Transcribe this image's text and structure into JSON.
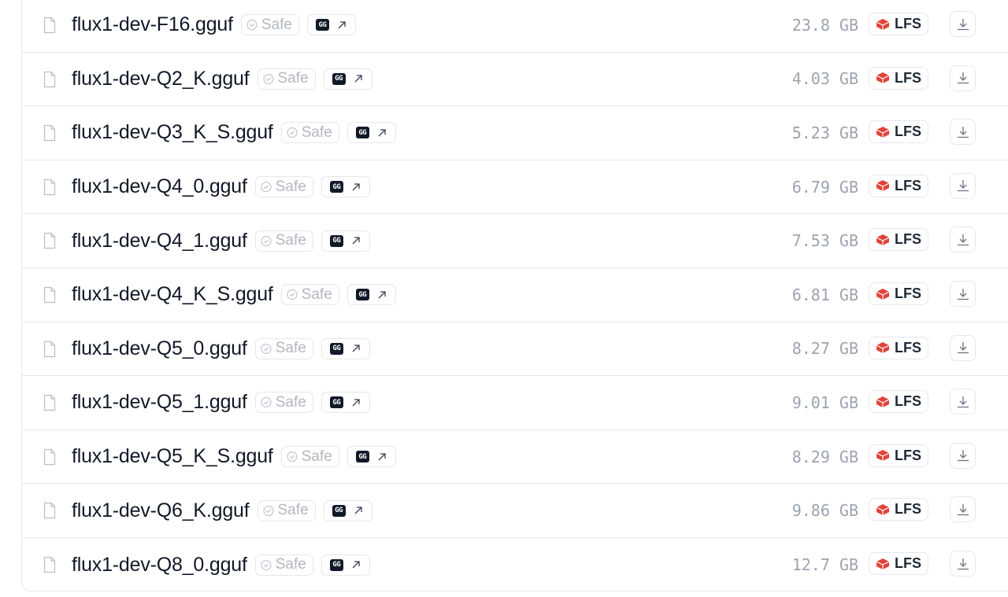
{
  "files": [
    {
      "name": "flux1-dev-F16.gguf",
      "safe_label": "Safe",
      "size": "23.8 GB",
      "lfs_label": "LFS"
    },
    {
      "name": "flux1-dev-Q2_K.gguf",
      "safe_label": "Safe",
      "size": "4.03 GB",
      "lfs_label": "LFS"
    },
    {
      "name": "flux1-dev-Q3_K_S.gguf",
      "safe_label": "Safe",
      "size": "5.23 GB",
      "lfs_label": "LFS"
    },
    {
      "name": "flux1-dev-Q4_0.gguf",
      "safe_label": "Safe",
      "size": "6.79 GB",
      "lfs_label": "LFS"
    },
    {
      "name": "flux1-dev-Q4_1.gguf",
      "safe_label": "Safe",
      "size": "7.53 GB",
      "lfs_label": "LFS"
    },
    {
      "name": "flux1-dev-Q4_K_S.gguf",
      "safe_label": "Safe",
      "size": "6.81 GB",
      "lfs_label": "LFS"
    },
    {
      "name": "flux1-dev-Q5_0.gguf",
      "safe_label": "Safe",
      "size": "8.27 GB",
      "lfs_label": "LFS"
    },
    {
      "name": "flux1-dev-Q5_1.gguf",
      "safe_label": "Safe",
      "size": "9.01 GB",
      "lfs_label": "LFS"
    },
    {
      "name": "flux1-dev-Q5_K_S.gguf",
      "safe_label": "Safe",
      "size": "8.29 GB",
      "lfs_label": "LFS"
    },
    {
      "name": "flux1-dev-Q6_K.gguf",
      "safe_label": "Safe",
      "size": "9.86 GB",
      "lfs_label": "LFS"
    },
    {
      "name": "flux1-dev-Q8_0.gguf",
      "safe_label": "Safe",
      "size": "12.7 GB",
      "lfs_label": "LFS"
    }
  ],
  "icons": {
    "file": "file-icon",
    "safe": "shield-check-icon",
    "gguf": "gguf-logo-icon",
    "external": "arrow-up-right-icon",
    "lfs": "lfs-icon",
    "download": "download-icon"
  },
  "colors": {
    "lfs_red": "#e0433a",
    "muted": "#9ca3af",
    "border": "#e5e7eb",
    "text": "#111827"
  }
}
